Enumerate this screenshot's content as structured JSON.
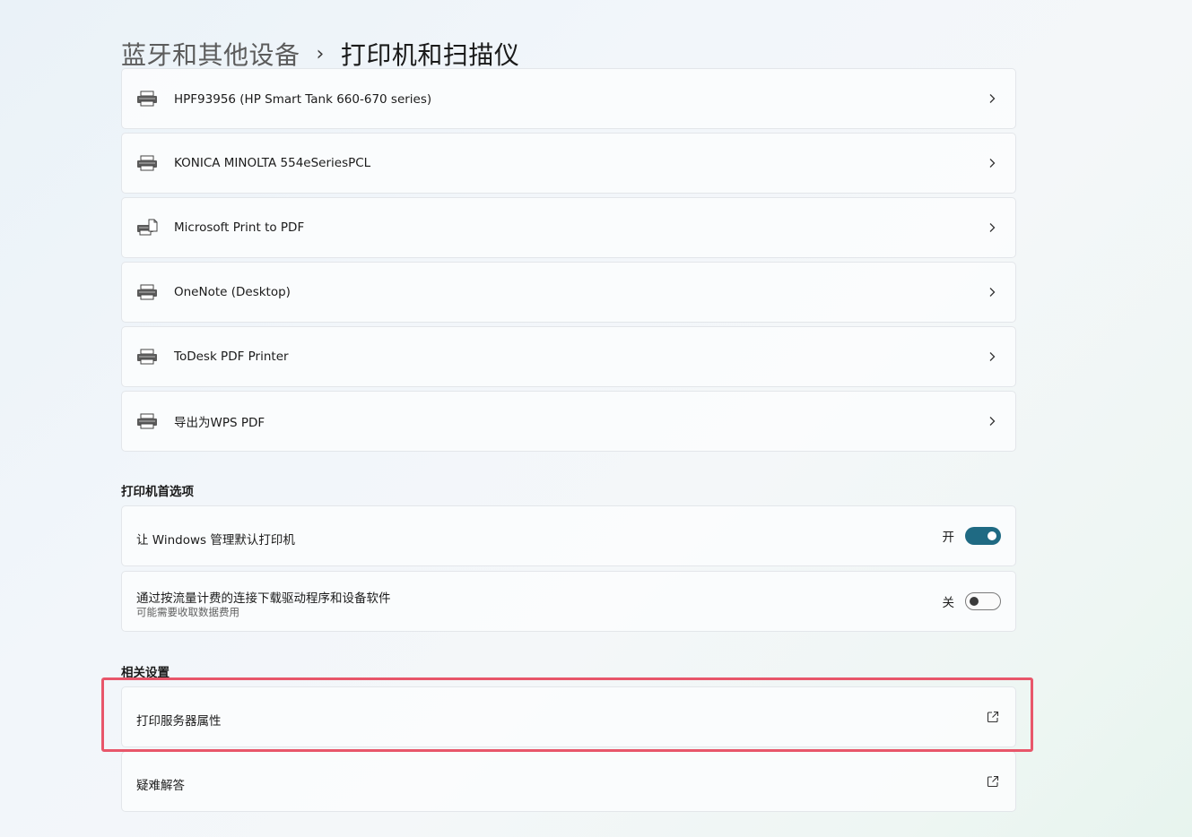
{
  "breadcrumb": {
    "parent": "蓝牙和其他设备",
    "separator": "›",
    "current": "打印机和扫描仪"
  },
  "devices": [
    {
      "label": "HPF93956 (HP Smart Tank 660-670 series)",
      "icon": "printer-icon"
    },
    {
      "label": "KONICA MINOLTA 554eSeriesPCL",
      "icon": "printer-icon"
    },
    {
      "label": "Microsoft Print to PDF",
      "icon": "pdf-printer-icon"
    },
    {
      "label": "OneNote (Desktop)",
      "icon": "printer-icon"
    },
    {
      "label": "ToDesk PDF Printer",
      "icon": "printer-icon"
    },
    {
      "label": "导出为WPS PDF",
      "icon": "printer-icon"
    }
  ],
  "preferences": {
    "title": "打印机首选项",
    "items": [
      {
        "label": "让 Windows 管理默认打印机",
        "subtitle": "",
        "state_label": "开",
        "on": true
      },
      {
        "label": "通过按流量计费的连接下载驱动程序和设备软件",
        "subtitle": "可能需要收取数据费用",
        "state_label": "关",
        "on": false
      }
    ]
  },
  "related": {
    "title": "相关设置",
    "items": [
      {
        "label": "打印服务器属性",
        "icon": "external-link-icon"
      },
      {
        "label": "疑难解答",
        "icon": "external-link-icon"
      }
    ]
  },
  "colors": {
    "accent": "#1f6a83",
    "highlight": "#e8566a"
  }
}
